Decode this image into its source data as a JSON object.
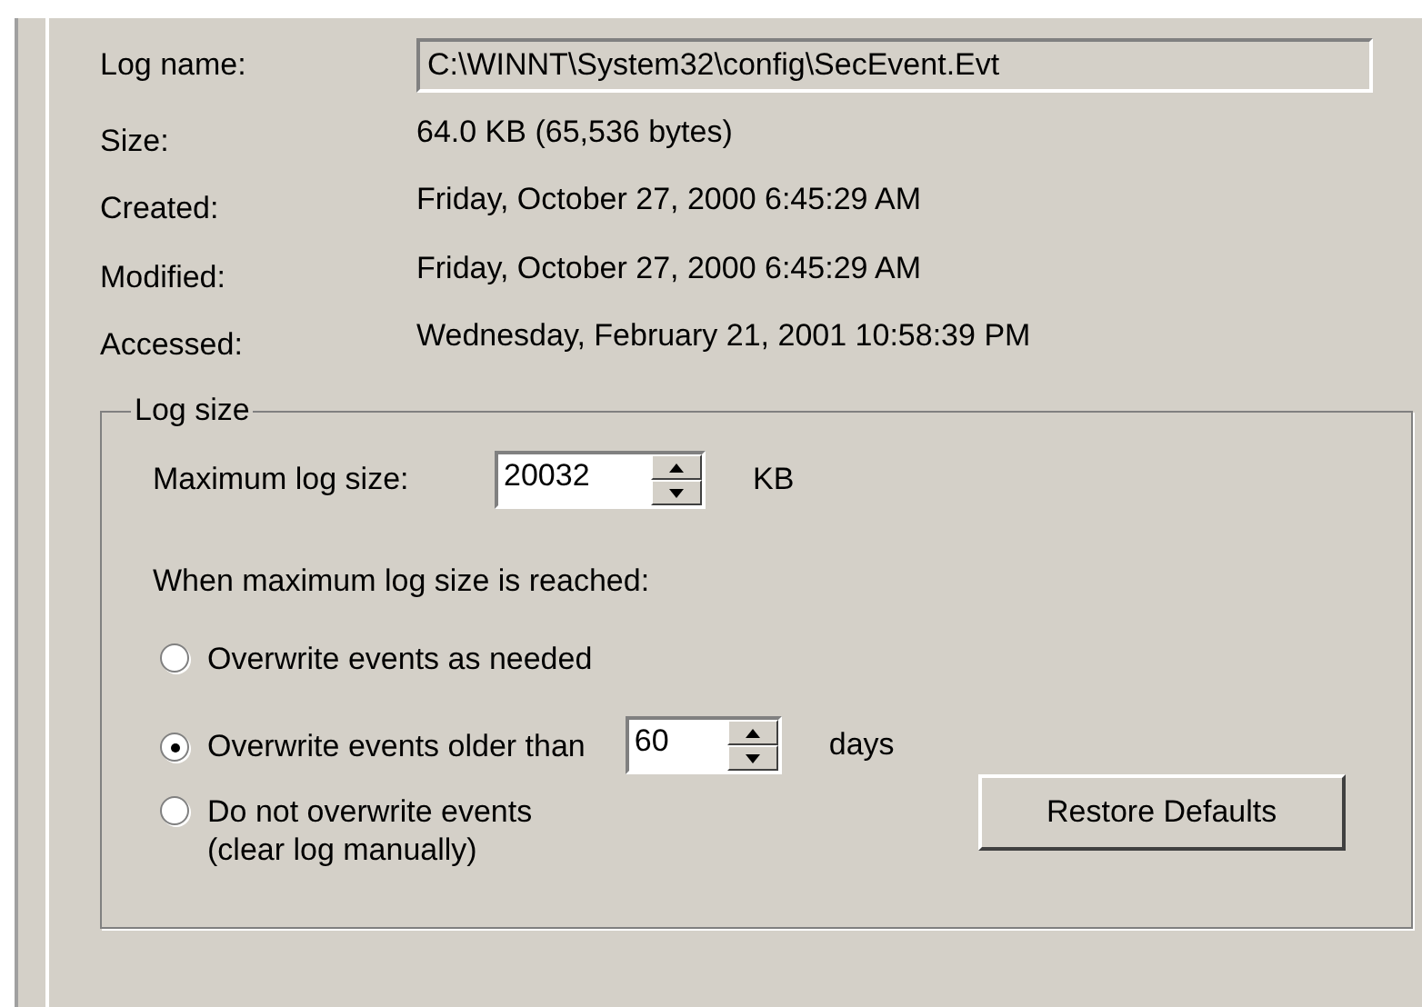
{
  "log_name": {
    "label": "Log name:",
    "value": "C:\\WINNT\\System32\\config\\SecEvent.Evt"
  },
  "properties": [
    {
      "label": "Size:",
      "value": "64.0 KB (65,536 bytes)"
    },
    {
      "label": "Created:",
      "value": "Friday, October 27, 2000 6:45:29 AM"
    },
    {
      "label": "Modified:",
      "value": "Friday, October 27, 2000 6:45:29 AM"
    },
    {
      "label": "Accessed:",
      "value": "Wednesday, February 21, 2001 10:58:39 PM"
    }
  ],
  "log_size": {
    "title": "Log size",
    "max_label": "Maximum log size:",
    "max_value": "20032",
    "max_unit": "KB",
    "when_label": "When maximum log size is reached:",
    "options": [
      {
        "label": "Overwrite events as needed",
        "selected": false
      },
      {
        "label": "Overwrite events older than",
        "selected": true,
        "days_value": "60",
        "days_unit": "days"
      },
      {
        "label": "Do not overwrite events",
        "note": "(clear log manually)",
        "selected": false
      }
    ],
    "restore_button": "Restore Defaults"
  }
}
